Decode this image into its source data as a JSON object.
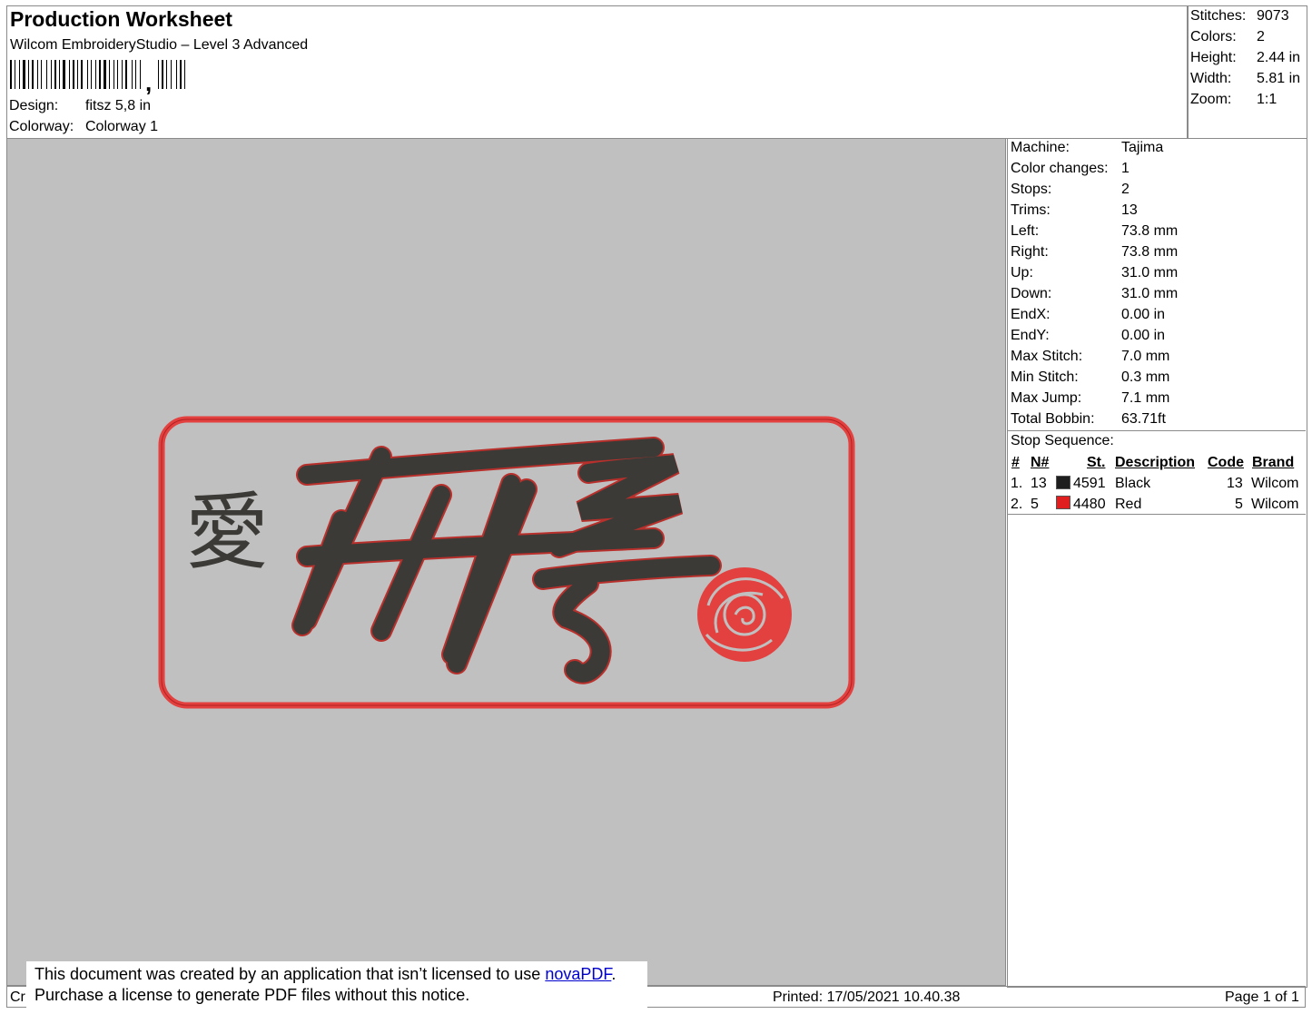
{
  "header": {
    "title": "Production Worksheet",
    "software": "Wilcom EmbroideryStudio – Level 3 Advanced",
    "barcode_suffix": ",",
    "design_label": "Design:",
    "design_value": "fitsz 5,8 in",
    "colorway_label": "Colorway:",
    "colorway_value": "Colorway 1"
  },
  "summary": [
    {
      "label": "Stitches:",
      "value": "9073"
    },
    {
      "label": "Colors:",
      "value": "2"
    },
    {
      "label": "Height:",
      "value": "2.44 in"
    },
    {
      "label": "Width:",
      "value": "5.81 in"
    },
    {
      "label": "Zoom:",
      "value": "1:1"
    }
  ],
  "machine_info": [
    {
      "label": "Machine:",
      "value": "Tajima"
    },
    {
      "label": "Color changes:",
      "value": "1"
    },
    {
      "label": "Stops:",
      "value": "2"
    },
    {
      "label": "Trims:",
      "value": "13"
    },
    {
      "label": "Left:",
      "value": "73.8 mm"
    },
    {
      "label": "Right:",
      "value": "73.8 mm"
    },
    {
      "label": "Up:",
      "value": "31.0 mm"
    },
    {
      "label": "Down:",
      "value": "31.0 mm"
    },
    {
      "label": "EndX:",
      "value": "0.00 in"
    },
    {
      "label": "EndY:",
      "value": "0.00 in"
    },
    {
      "label": "Max Stitch:",
      "value": "7.0 mm"
    },
    {
      "label": "Min Stitch:",
      "value": "0.3 mm"
    },
    {
      "label": "Max Jump:",
      "value": "7.1 mm"
    },
    {
      "label": "Total Bobbin:",
      "value": "63.71ft"
    }
  ],
  "stop_sequence": {
    "title": "Stop Sequence:",
    "headers": {
      "num": "#",
      "n": "N#",
      "st": "St.",
      "desc": "Description",
      "code": "Code",
      "brand": "Brand"
    },
    "rows": [
      {
        "num": "1.",
        "n": "13",
        "color": "#1e1e1e",
        "st": "4591",
        "desc": "Black",
        "code": "13",
        "brand": "Wilcom"
      },
      {
        "num": "2.",
        "n": "5",
        "color": "#e02020",
        "st": "4480",
        "desc": "Red",
        "code": "5",
        "brand": "Wilcom"
      }
    ]
  },
  "design": {
    "kanji": "愛",
    "thread_black": "#3c3a36",
    "thread_red": "#e2413f",
    "background": "#c0c0c0"
  },
  "footer": {
    "left_text": "Cr",
    "notice_line1_a": "This document was created by an application that isn’t licensed to use ",
    "notice_link": "novaPDF",
    "notice_line1_b": ".",
    "notice_line2": "Purchase a license to generate PDF files without this notice.",
    "printed": "Printed: 17/05/2021 10.40.38",
    "page": "Page 1 of 1"
  }
}
